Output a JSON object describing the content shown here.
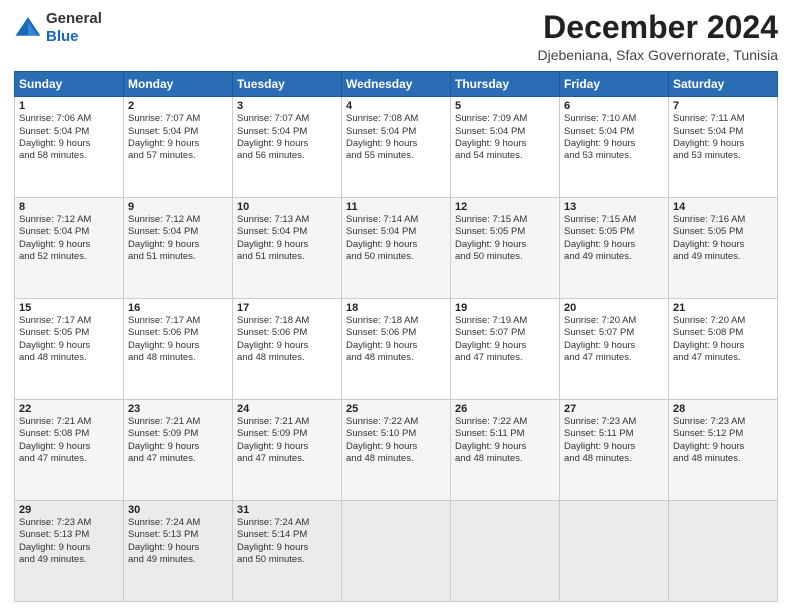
{
  "logo": {
    "general": "General",
    "blue": "Blue"
  },
  "header": {
    "month": "December 2024",
    "location": "Djebeniana, Sfax Governorate, Tunisia"
  },
  "weekdays": [
    "Sunday",
    "Monday",
    "Tuesday",
    "Wednesday",
    "Thursday",
    "Friday",
    "Saturday"
  ],
  "weeks": [
    [
      {
        "day": 1,
        "sunrise": "7:06 AM",
        "sunset": "5:04 PM",
        "daylight": "9 hours and 58 minutes."
      },
      {
        "day": 2,
        "sunrise": "7:07 AM",
        "sunset": "5:04 PM",
        "daylight": "9 hours and 57 minutes."
      },
      {
        "day": 3,
        "sunrise": "7:07 AM",
        "sunset": "5:04 PM",
        "daylight": "9 hours and 56 minutes."
      },
      {
        "day": 4,
        "sunrise": "7:08 AM",
        "sunset": "5:04 PM",
        "daylight": "9 hours and 55 minutes."
      },
      {
        "day": 5,
        "sunrise": "7:09 AM",
        "sunset": "5:04 PM",
        "daylight": "9 hours and 54 minutes."
      },
      {
        "day": 6,
        "sunrise": "7:10 AM",
        "sunset": "5:04 PM",
        "daylight": "9 hours and 53 minutes."
      },
      {
        "day": 7,
        "sunrise": "7:11 AM",
        "sunset": "5:04 PM",
        "daylight": "9 hours and 53 minutes."
      }
    ],
    [
      {
        "day": 8,
        "sunrise": "7:12 AM",
        "sunset": "5:04 PM",
        "daylight": "9 hours and 52 minutes."
      },
      {
        "day": 9,
        "sunrise": "7:12 AM",
        "sunset": "5:04 PM",
        "daylight": "9 hours and 51 minutes."
      },
      {
        "day": 10,
        "sunrise": "7:13 AM",
        "sunset": "5:04 PM",
        "daylight": "9 hours and 51 minutes."
      },
      {
        "day": 11,
        "sunrise": "7:14 AM",
        "sunset": "5:04 PM",
        "daylight": "9 hours and 50 minutes."
      },
      {
        "day": 12,
        "sunrise": "7:15 AM",
        "sunset": "5:05 PM",
        "daylight": "9 hours and 50 minutes."
      },
      {
        "day": 13,
        "sunrise": "7:15 AM",
        "sunset": "5:05 PM",
        "daylight": "9 hours and 49 minutes."
      },
      {
        "day": 14,
        "sunrise": "7:16 AM",
        "sunset": "5:05 PM",
        "daylight": "9 hours and 49 minutes."
      }
    ],
    [
      {
        "day": 15,
        "sunrise": "7:17 AM",
        "sunset": "5:05 PM",
        "daylight": "9 hours and 48 minutes."
      },
      {
        "day": 16,
        "sunrise": "7:17 AM",
        "sunset": "5:06 PM",
        "daylight": "9 hours and 48 minutes."
      },
      {
        "day": 17,
        "sunrise": "7:18 AM",
        "sunset": "5:06 PM",
        "daylight": "9 hours and 48 minutes."
      },
      {
        "day": 18,
        "sunrise": "7:18 AM",
        "sunset": "5:06 PM",
        "daylight": "9 hours and 48 minutes."
      },
      {
        "day": 19,
        "sunrise": "7:19 AM",
        "sunset": "5:07 PM",
        "daylight": "9 hours and 47 minutes."
      },
      {
        "day": 20,
        "sunrise": "7:20 AM",
        "sunset": "5:07 PM",
        "daylight": "9 hours and 47 minutes."
      },
      {
        "day": 21,
        "sunrise": "7:20 AM",
        "sunset": "5:08 PM",
        "daylight": "9 hours and 47 minutes."
      }
    ],
    [
      {
        "day": 22,
        "sunrise": "7:21 AM",
        "sunset": "5:08 PM",
        "daylight": "9 hours and 47 minutes."
      },
      {
        "day": 23,
        "sunrise": "7:21 AM",
        "sunset": "5:09 PM",
        "daylight": "9 hours and 47 minutes."
      },
      {
        "day": 24,
        "sunrise": "7:21 AM",
        "sunset": "5:09 PM",
        "daylight": "9 hours and 47 minutes."
      },
      {
        "day": 25,
        "sunrise": "7:22 AM",
        "sunset": "5:10 PM",
        "daylight": "9 hours and 48 minutes."
      },
      {
        "day": 26,
        "sunrise": "7:22 AM",
        "sunset": "5:11 PM",
        "daylight": "9 hours and 48 minutes."
      },
      {
        "day": 27,
        "sunrise": "7:23 AM",
        "sunset": "5:11 PM",
        "daylight": "9 hours and 48 minutes."
      },
      {
        "day": 28,
        "sunrise": "7:23 AM",
        "sunset": "5:12 PM",
        "daylight": "9 hours and 48 minutes."
      }
    ],
    [
      {
        "day": 29,
        "sunrise": "7:23 AM",
        "sunset": "5:13 PM",
        "daylight": "9 hours and 49 minutes."
      },
      {
        "day": 30,
        "sunrise": "7:24 AM",
        "sunset": "5:13 PM",
        "daylight": "9 hours and 49 minutes."
      },
      {
        "day": 31,
        "sunrise": "7:24 AM",
        "sunset": "5:14 PM",
        "daylight": "9 hours and 50 minutes."
      },
      null,
      null,
      null,
      null
    ]
  ],
  "labels": {
    "sunrise": "Sunrise:",
    "sunset": "Sunset:",
    "daylight": "Daylight:"
  }
}
